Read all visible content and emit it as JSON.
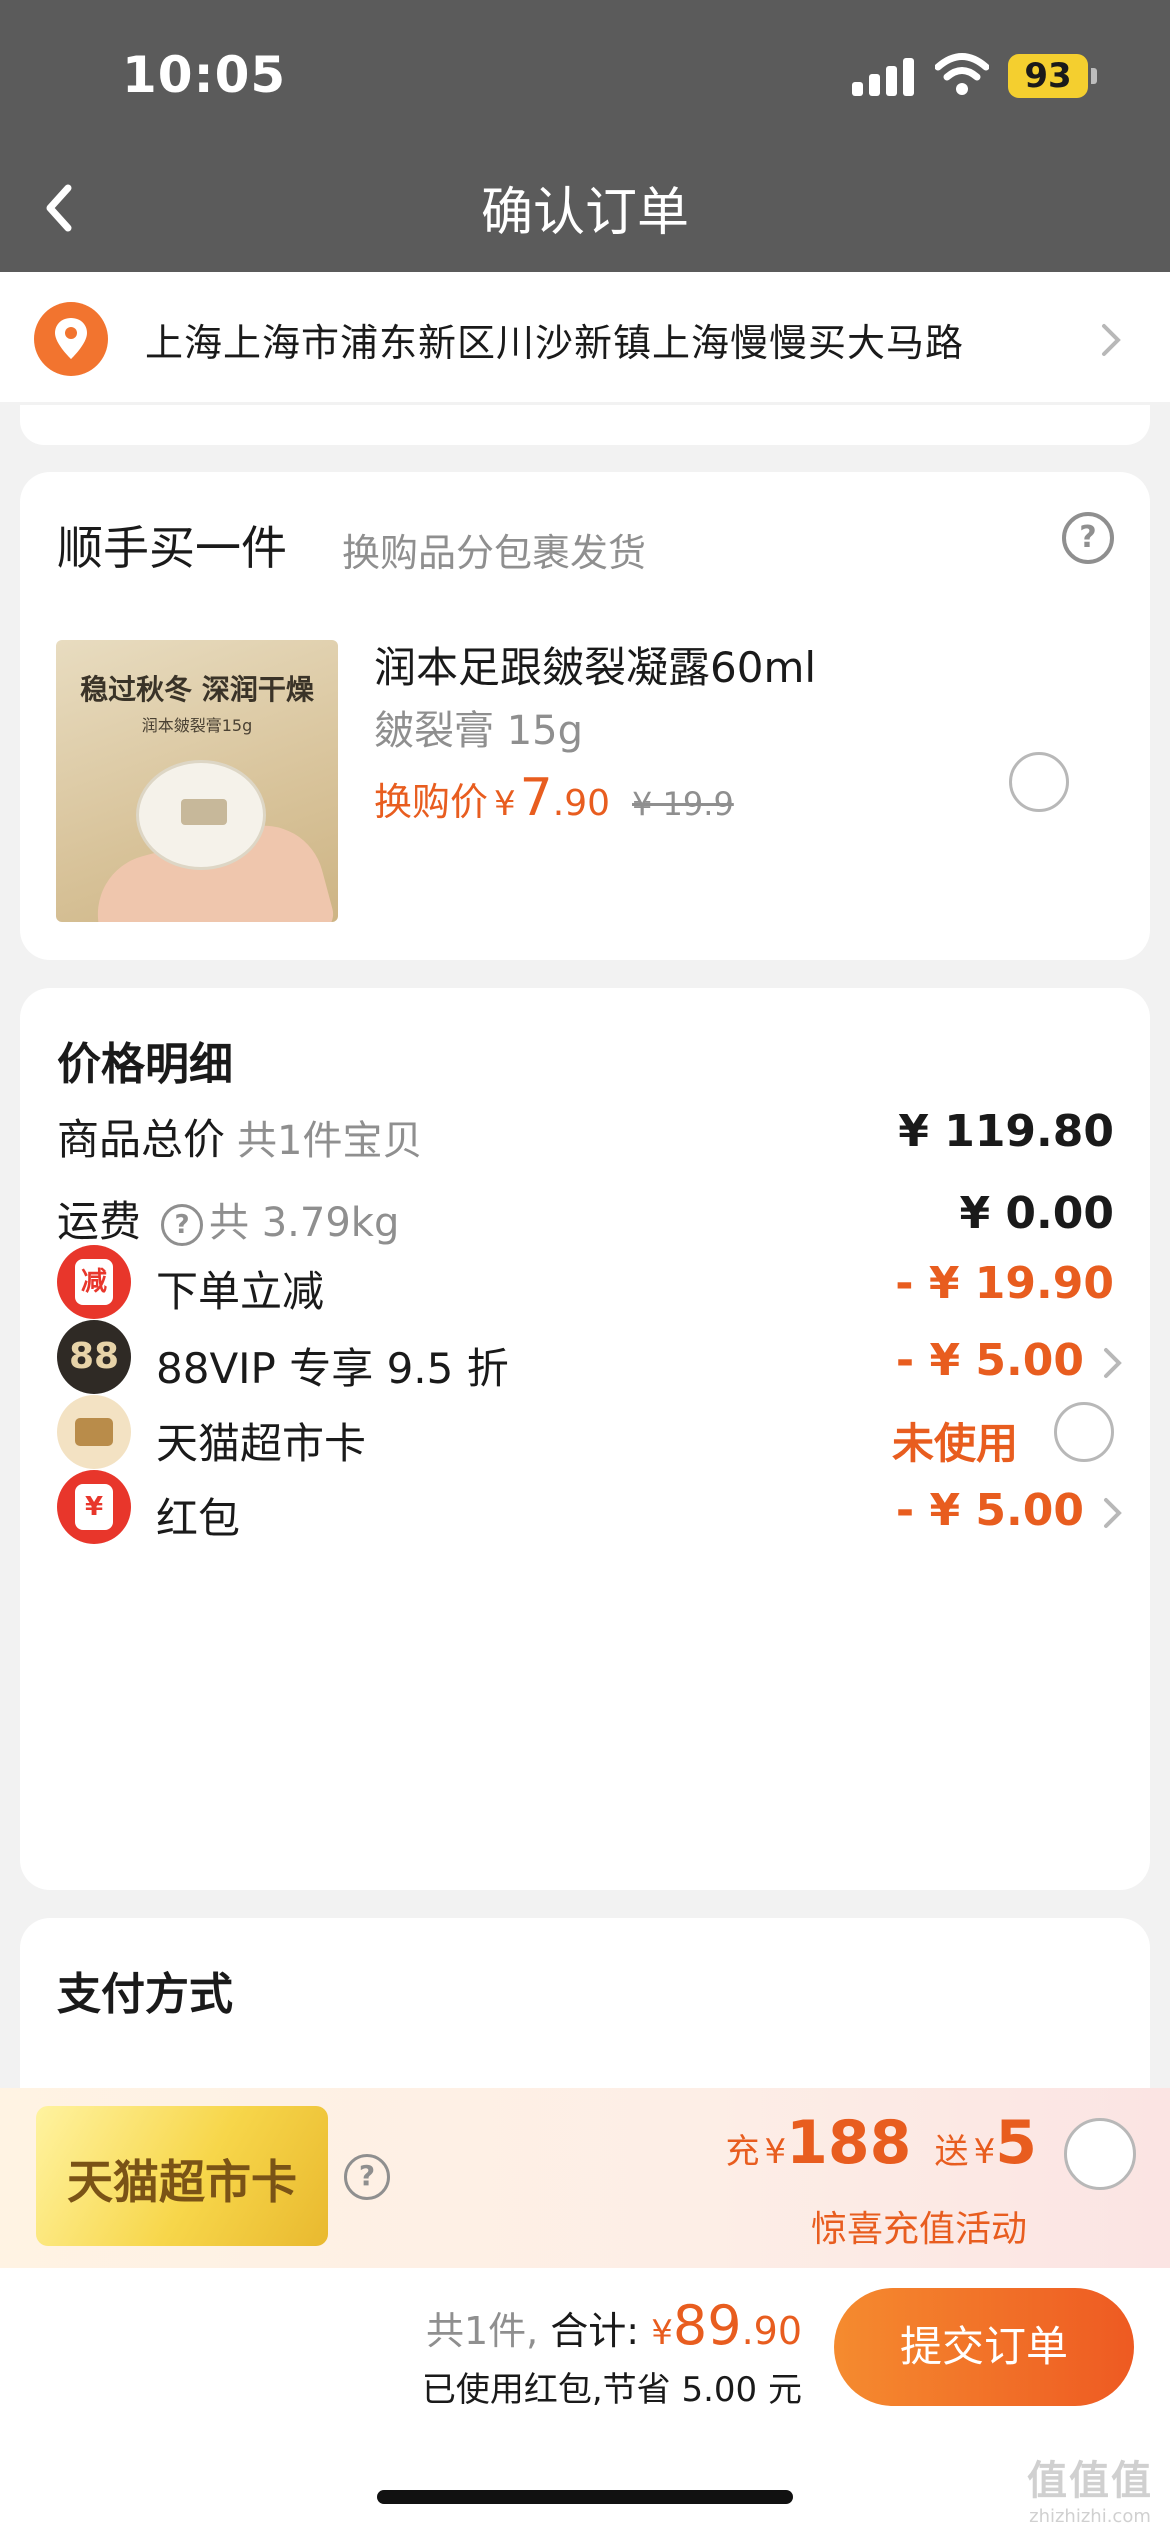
{
  "status_bar": {
    "time": "10:05",
    "battery": "93"
  },
  "header": {
    "title": "确认订单"
  },
  "address": {
    "text": "上海上海市浦东新区川沙新镇上海慢慢买大马路"
  },
  "addon": {
    "title": "顺手买一件",
    "subtitle": "换购品分包裹发货",
    "image_title": "稳过秋冬 深润干燥",
    "image_subtitle": "润本皴裂膏15g",
    "product_name": "润本足跟皴裂凝露60ml",
    "product_spec": "皴裂膏 15g",
    "price_label": "换购价",
    "currency": "¥",
    "price_int": "7",
    "price_dec": ".90",
    "price_old": "¥ 19.9"
  },
  "price_detail": {
    "title": "价格明细",
    "rows": [
      {
        "label": "商品总价",
        "note": "共1件宝贝",
        "value": "¥ 119.80"
      },
      {
        "label": "运费",
        "help": "?",
        "note": "共 3.79kg",
        "value": "¥ 0.00"
      },
      {
        "label": "下单立减",
        "badge": "减",
        "value": "- ¥ 19.90"
      },
      {
        "label": "88VIP 专享 9.5 折",
        "badge": "88",
        "value": "- ¥ 5.00"
      },
      {
        "label": "天猫超市卡",
        "value": "未使用"
      },
      {
        "label": "红包",
        "badge": "¥",
        "value": "- ¥ 5.00"
      }
    ]
  },
  "payment": {
    "title": "支付方式"
  },
  "promo": {
    "card_text": "天猫超市卡",
    "help": "?",
    "charge_label": "充",
    "currency": "¥",
    "charge_amount": "188",
    "gift_label": "送",
    "gift_amount": "5",
    "subtitle": "惊喜充值活动"
  },
  "bottom_bar": {
    "count": "共1件,",
    "total_label": "合计:",
    "currency": "¥",
    "total_int": "89",
    "total_dec": ".90",
    "saved": "已使用红包,节省 5.00 元",
    "submit": "提交订单"
  },
  "watermark": {
    "mark": "值值值",
    "domain": "zhizhizhi.com"
  },
  "colors": {
    "accent": "#e85d1f",
    "header_bg": "#5b5b5b",
    "battery": "#f4cf2f"
  }
}
